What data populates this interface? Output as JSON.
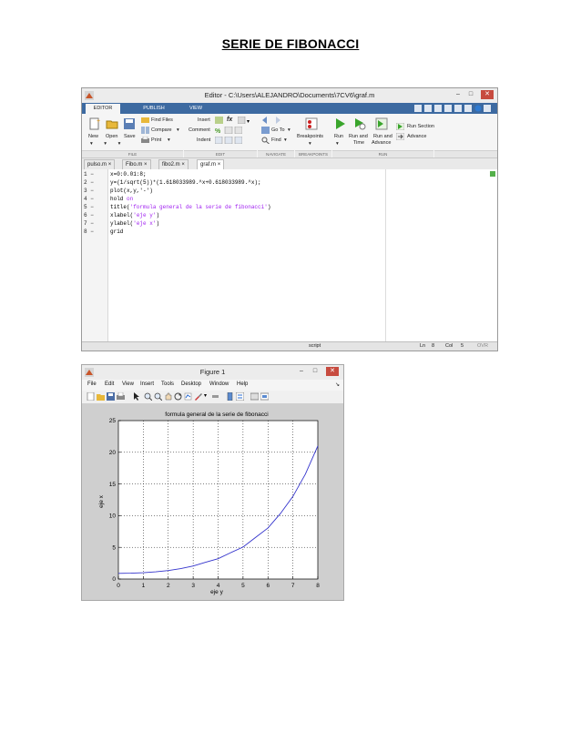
{
  "document": {
    "title": "SERIE DE FIBONACCI"
  },
  "editor": {
    "window_title": "Editor - C:\\Users\\ALEJANDRO\\Documents\\7CV6\\graf.m",
    "ribbon_tabs": [
      "EDITOR",
      "PUBLISH",
      "VIEW"
    ],
    "ribbon": {
      "file": {
        "new": "New",
        "open": "Open",
        "save": "Save",
        "find_files": "Find Files",
        "compare": "Compare",
        "print": "Print",
        "group": "FILE"
      },
      "edit": {
        "insert": "Insert",
        "comment": "Comment",
        "indent": "Indent",
        "fx": "fx",
        "group": "EDIT"
      },
      "navigate": {
        "go_to": "Go To",
        "find": "Find",
        "group": "NAVIGATE"
      },
      "breakpoints": {
        "label": "Breakpoints",
        "group": "BREAKPOINTS"
      },
      "run": {
        "run": "Run",
        "run_and_time_1": "Run and",
        "run_and_time_2": "Time",
        "run_and_advance_1": "Run and",
        "run_and_advance_2": "Advance",
        "run_section": "Run Section",
        "advance": "Advance",
        "group": "RUN"
      }
    },
    "file_tabs": [
      "pulso.m",
      "Fibo.m",
      "fibo2.m",
      "graf.m"
    ],
    "active_tab": "graf.m",
    "line_numbers": [
      "1 −",
      "2 −",
      "3 −",
      "4 −",
      "5 −",
      "6 −",
      "7 −",
      "8 −"
    ],
    "code": {
      "l1": "x=0:0.01:8;",
      "l2": "y=(1/sqrt(5))*(1.618033989.^x+0.618033989.^x);",
      "l3": "plot(x,y,'-')",
      "l4a": "hold ",
      "l4b": "on",
      "l5a": "title(",
      "l5b": "'formula general de la serie de fibonacci'",
      "l5c": ")",
      "l6a": "xlabel(",
      "l6b": "'eje y'",
      "l6c": ")",
      "l7a": "ylabel(",
      "l7b": "'eje x'",
      "l7c": ")",
      "l8": "grid"
    },
    "status": {
      "mode": "script",
      "ln_label": "Ln",
      "ln": "8",
      "col_label": "Col",
      "col": "5",
      "ovr": "OVR"
    }
  },
  "figure": {
    "window_title": "Figure 1",
    "menu": [
      "File",
      "Edit",
      "View",
      "Insert",
      "Tools",
      "Desktop",
      "Window",
      "Help"
    ]
  },
  "chart_data": {
    "type": "line",
    "title": "formula general de la serie de fibonacci",
    "xlabel": "eje y",
    "ylabel": "eje x",
    "xlim": [
      0,
      8
    ],
    "ylim": [
      0,
      25
    ],
    "xticks": [
      "0",
      "1",
      "2",
      "3",
      "4",
      "5",
      "6",
      "7",
      "8"
    ],
    "yticks": [
      "0",
      "5",
      "10",
      "15",
      "20",
      "25"
    ],
    "grid": true,
    "series": [
      {
        "x": [
          0,
          0.5,
          1,
          1.5,
          2,
          2.5,
          3,
          3.5,
          4,
          4.5,
          5,
          5.5,
          6,
          6.5,
          7,
          7.5,
          8
        ],
        "y": [
          0.89,
          0.92,
          1.0,
          1.14,
          1.34,
          1.64,
          2.06,
          2.65,
          3.21,
          4.15,
          5.05,
          6.56,
          8.05,
          10.33,
          13.03,
          16.55,
          21.0
        ],
        "color": "#3333cc"
      }
    ]
  }
}
